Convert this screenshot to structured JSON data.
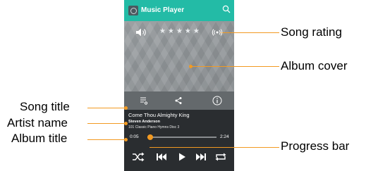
{
  "app": {
    "title": "Music Player"
  },
  "cover": {
    "rating_stars": 5
  },
  "song": {
    "title": "Come Thou Almighty King",
    "artist": "Steven Anderson",
    "album": "101 Classic Piano Hymns Disc 3"
  },
  "progress": {
    "elapsed": "0:05",
    "total": "2:24",
    "fraction": 0.04
  },
  "callouts": {
    "song_rating": "Song rating",
    "album_cover": "Album cover",
    "song_title": "Song title",
    "artist_name": "Artist name",
    "album_title": "Album title",
    "progress_bar": "Progress bar"
  },
  "colors": {
    "header": "#23bba6",
    "accent": "#f29a22",
    "panel": "#2a2d30"
  },
  "icons": [
    "search-icon",
    "volume-icon",
    "cast-icon",
    "queue-icon",
    "share-icon",
    "info-icon",
    "shuffle-icon",
    "previous-icon",
    "play-icon",
    "next-icon",
    "repeat-icon"
  ]
}
